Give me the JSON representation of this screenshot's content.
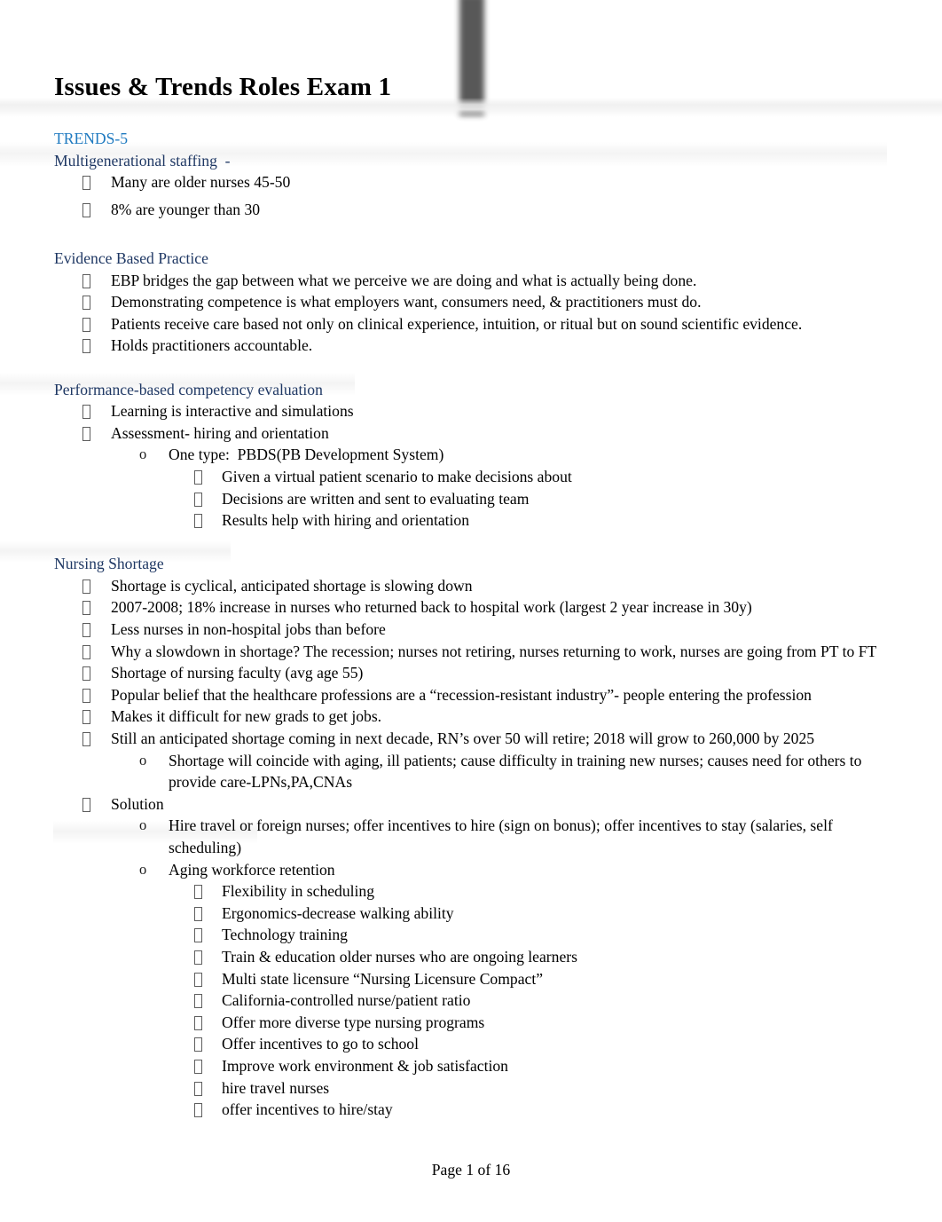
{
  "document": {
    "title": "Issues & Trends Roles Exam 1",
    "footer": "Page 1 of 16",
    "colors": {
      "accent_blue": "#1f7ac0",
      "navy_blue": "#1f3864",
      "body_text": "#000000",
      "page_background": "#ffffff",
      "artifact_gray": "#4a4a4a"
    },
    "markers": {
      "level1": "tofu-box",
      "level2": "o",
      "level3": "tofu-box"
    }
  },
  "sections": [
    {
      "heading": "TRENDS-5",
      "heading_style": "accent",
      "subheading": "Multigenerational staffing  -",
      "subheading_style": "navy",
      "items": [
        {
          "level": 1,
          "text": "Many are older nurses 45-50"
        },
        {
          "level": 1,
          "text": "8% are younger than 30"
        }
      ]
    },
    {
      "heading": "Evidence Based Practice",
      "heading_style": "navy",
      "items": [
        {
          "level": 1,
          "text": "EBP bridges the gap between what we perceive we are doing and what is actually being done."
        },
        {
          "level": 1,
          "text": "Demonstrating competence is what employers want, consumers need, & practitioners must do."
        },
        {
          "level": 1,
          "text": "Patients receive care based not only on clinical experience, intuition, or ritual but on sound scientific evidence."
        },
        {
          "level": 1,
          "text": "Holds practitioners accountable."
        }
      ]
    },
    {
      "heading": "Performance-based competency evaluation",
      "heading_style": "navy",
      "items": [
        {
          "level": 1,
          "text": "Learning is interactive and simulations"
        },
        {
          "level": 1,
          "text": "Assessment- hiring and orientation"
        },
        {
          "level": 2,
          "text": "One type:  PBDS(PB Development System)"
        },
        {
          "level": 3,
          "text": "Given a virtual patient scenario to make decisions about"
        },
        {
          "level": 3,
          "text": "Decisions are written and sent to evaluating team"
        },
        {
          "level": 3,
          "text": "Results help with hiring and orientation"
        }
      ]
    },
    {
      "heading": "Nursing Shortage",
      "heading_style": "navy",
      "items": [
        {
          "level": 1,
          "text": "Shortage is cyclical, anticipated shortage is slowing down"
        },
        {
          "level": 1,
          "text": "2007-2008; 18% increase in nurses who returned back to hospital work (largest 2 year increase in 30y)"
        },
        {
          "level": 1,
          "text": "Less nurses in non-hospital jobs than before"
        },
        {
          "level": 1,
          "text": "Why a slowdown in shortage? The recession; nurses not retiring, nurses returning to work, nurses are going from PT to FT"
        },
        {
          "level": 1,
          "text": "Shortage of nursing faculty (avg age 55)"
        },
        {
          "level": 1,
          "text": "Popular belief that the healthcare professions are a “recession-resistant industry”- people entering the profession"
        },
        {
          "level": 1,
          "text": "Makes it difficult for new grads to get jobs."
        },
        {
          "level": 1,
          "text": "Still an anticipated shortage coming in next decade, RN’s over 50 will retire; 2018 will grow to 260,000 by 2025"
        },
        {
          "level": 2,
          "text": "Shortage will coincide with aging, ill patients; cause difficulty in training new nurses; causes need for others to provide care-LPNs,PA,CNAs"
        },
        {
          "level": 1,
          "text": "Solution"
        },
        {
          "level": 2,
          "text": "Hire travel or foreign nurses; offer incentives to hire (sign on bonus); offer incentives to stay (salaries, self scheduling)"
        },
        {
          "level": 2,
          "text": "Aging workforce retention"
        },
        {
          "level": 3,
          "text": "Flexibility in scheduling"
        },
        {
          "level": 3,
          "text": "Ergonomics-decrease walking ability"
        },
        {
          "level": 3,
          "text": "Technology training"
        },
        {
          "level": 3,
          "text": "Train & education older nurses who are ongoing learners"
        },
        {
          "level": 3,
          "text": "Multi state licensure “Nursing Licensure Compact”"
        },
        {
          "level": 3,
          "text": "California-controlled nurse/patient ratio"
        },
        {
          "level": 3,
          "text": "Offer more diverse type nursing programs"
        },
        {
          "level": 3,
          "text": "Offer incentives to go to school"
        },
        {
          "level": 3,
          "text": "Improve work environment & job satisfaction"
        },
        {
          "level": 3,
          "text": "hire travel nurses"
        },
        {
          "level": 3,
          "text": "offer incentives to hire/stay"
        }
      ]
    }
  ]
}
